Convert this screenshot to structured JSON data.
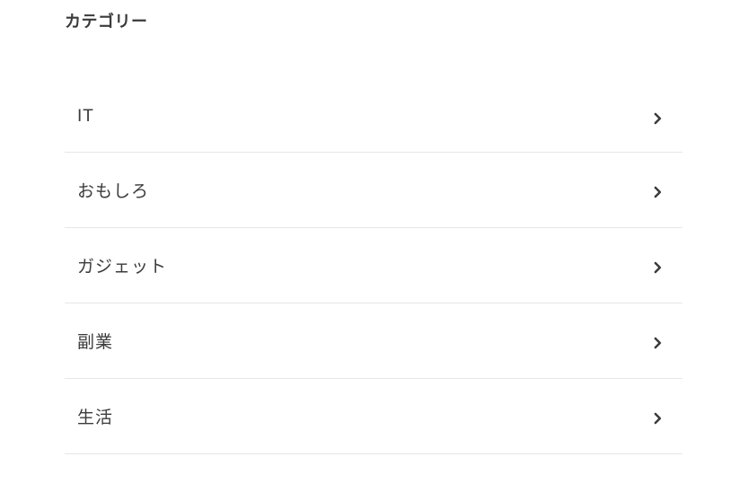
{
  "section": {
    "title": "カテゴリー"
  },
  "categories": {
    "items": [
      {
        "label": "IT"
      },
      {
        "label": "おもしろ"
      },
      {
        "label": "ガジェット"
      },
      {
        "label": "副業"
      },
      {
        "label": "生活"
      }
    ]
  }
}
